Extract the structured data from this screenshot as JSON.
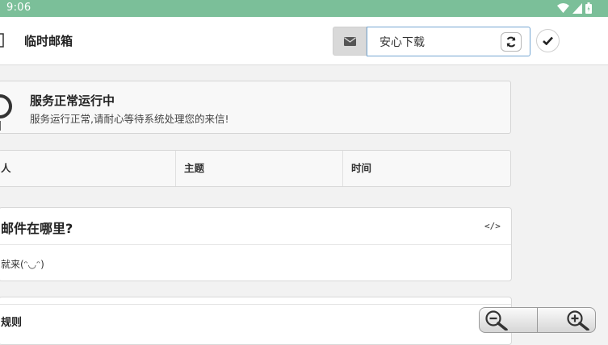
{
  "status_bar": {
    "time": "9:06"
  },
  "navbar": {
    "title": "临时邮箱",
    "mail_addon_icon": "envelope-icon",
    "address_value": "安心下载",
    "refresh_icon": "refresh-icon",
    "confirm_icon": "check-icon"
  },
  "service_status": {
    "title": "服务正常运行中",
    "description": "服务运行正常,请耐心等待系统处理您的来信!"
  },
  "mail_table": {
    "columns": [
      "人",
      "主题",
      "时间"
    ]
  },
  "faq": {
    "title": "邮件在哪里?",
    "code_icon": "</>",
    "body": "就来(ᵔ◡ᵔ)"
  },
  "rules": {
    "title": "规则"
  },
  "zoom": {
    "out_icon": "zoom-out-icon",
    "in_icon": "zoom-in-icon"
  },
  "colors": {
    "status_bar": "#7bbf99",
    "input_border": "#74a6d2"
  }
}
